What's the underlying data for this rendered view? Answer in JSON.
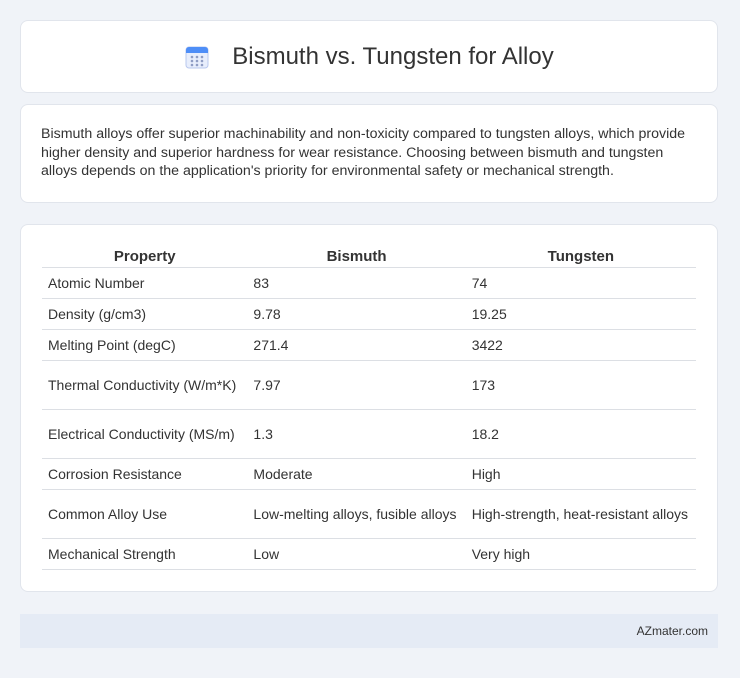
{
  "header": {
    "title": "Bismuth vs. Tungsten for Alloy",
    "icon": "calendar-icon"
  },
  "intro": {
    "text": "Bismuth alloys offer superior machinability and non-toxicity compared to tungsten alloys, which provide higher density and superior hardness for wear resistance. Choosing between bismuth and tungsten alloys depends on the application's priority for environmental safety or mechanical strength."
  },
  "table": {
    "headers": [
      "Property",
      "Bismuth",
      "Tungsten"
    ],
    "rows": [
      [
        "Atomic Number",
        "83",
        "74"
      ],
      [
        "Density (g/cm3)",
        "9.78",
        "19.25"
      ],
      [
        "Melting Point (degC)",
        "271.4",
        "3422"
      ],
      [
        "Thermal Conductivity (W/m*K)",
        "7.97",
        "173"
      ],
      [
        "Electrical Conductivity (MS/m)",
        "1.3",
        "18.2"
      ],
      [
        "Corrosion Resistance",
        "Moderate",
        "High"
      ],
      [
        "Common Alloy Use",
        "Low-melting alloys, fusible alloys",
        "High-strength, heat-resistant alloys"
      ],
      [
        "Mechanical Strength",
        "Low",
        "Very high"
      ]
    ]
  },
  "footer": {
    "site": "AZmater.com"
  },
  "colors": {
    "background": "#f0f3f8",
    "card": "#ffffff",
    "footer": "#e5ebf5",
    "icon_blue": "#4e8ef7"
  }
}
